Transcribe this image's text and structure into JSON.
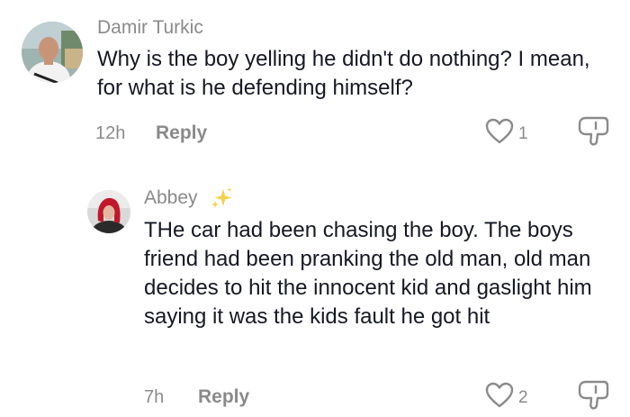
{
  "comments": [
    {
      "author": "Damir Turkic",
      "text": "Why is the boy yelling he didn't do nothing? I mean, for what is he defending himself?",
      "time": "12h",
      "reply_label": "Reply",
      "likes": "1"
    },
    {
      "author": "Abbey",
      "author_badge": "sparkles-icon",
      "text": "THe car had been chasing the boy. The boys friend had been pranking the old man, old man decides to hit the innocent kid and gaslight him saying it was the kids fault he got hit",
      "time": "7h",
      "reply_label": "Reply",
      "likes": "2"
    }
  ],
  "colors": {
    "text": "#161823",
    "muted": "#8a8a8a",
    "sparkle": "#f2d24b"
  }
}
